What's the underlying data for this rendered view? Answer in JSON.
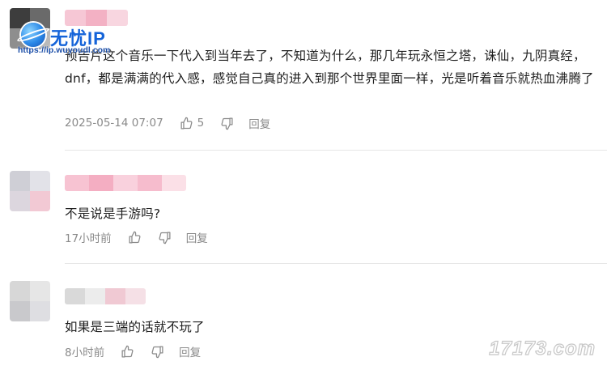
{
  "watermark": {
    "brand": "无忧IP",
    "url": "https://ip.wuyoudl.com"
  },
  "corner_watermark": "17173.com",
  "actions": {
    "reply_label": "回复",
    "like_icon": "thumbs-up-icon",
    "dislike_icon": "thumbs-down-icon"
  },
  "comments": [
    {
      "text": "预告片这个音乐一下代入到当年去了，不知道为什么，那几年玩永恒之塔，诛仙，九阴真经，dnf，都是满满的代入感，感觉自己真的进入到那个世界里面一样，光是听着音乐就热血沸腾了",
      "time": "2025-05-14 07:07",
      "likes": "5"
    },
    {
      "text": "不是说是手游吗?",
      "time": "17小时前",
      "likes": ""
    },
    {
      "text": "如果是三端的话就不玩了",
      "time": "8小时前",
      "likes": ""
    }
  ],
  "colors": {
    "brand_blue": "#1463d9",
    "meta_gray": "#8a8a8a",
    "divider": "#e6e6e6"
  }
}
